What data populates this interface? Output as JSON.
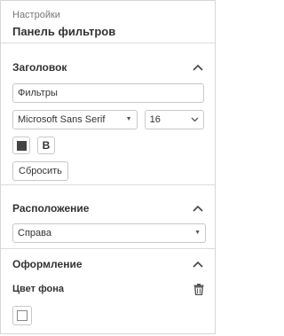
{
  "header": {
    "breadcrumb": "Настройки",
    "title": "Панель фильтров"
  },
  "title_section": {
    "heading": "Заголовок",
    "text_value": "Фильтры",
    "font_family": "Microsoft Sans Serif",
    "font_size": "16",
    "bold_label": "B",
    "reset_label": "Сбросить",
    "text_color": "#444444"
  },
  "position_section": {
    "heading": "Расположение",
    "value": "Справа"
  },
  "style_section": {
    "heading": "Оформление",
    "bg_color_label": "Цвет фона",
    "bg_color": "#ffffff"
  },
  "icons": {
    "collapse": "chevron-up-icon",
    "dropdown": "caret-down-icon",
    "delete": "trash-icon"
  }
}
